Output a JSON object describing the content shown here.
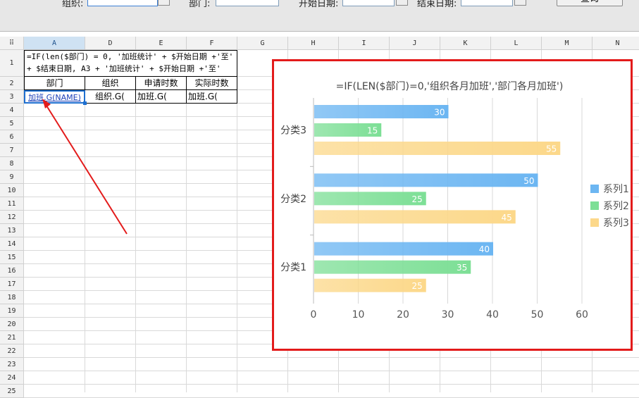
{
  "params": {
    "group_label": "组织:",
    "dept_label": "部门:",
    "start_label": "开始日期:",
    "end_label": "结束日期:",
    "query_button": "查询"
  },
  "sheet": {
    "columns": [
      "A",
      "D",
      "E",
      "F",
      "G",
      "H",
      "I",
      "J",
      "K",
      "L",
      "M",
      "N"
    ],
    "selected_column": "A",
    "rows": [
      "1",
      "2",
      "3",
      "4",
      "5",
      "6",
      "7",
      "8",
      "9",
      "10",
      "11",
      "12",
      "13",
      "14",
      "15",
      "16",
      "17",
      "18",
      "19",
      "20",
      "21",
      "22",
      "23",
      "24",
      "25"
    ],
    "formula_line1": "=IF(len($部门) = 0, '加班统计' + $开始日期 +'至'",
    "formula_line2": "+ $结束日期, A3 + '加班统计' + $开始日期 +'至'",
    "headers": [
      "部门",
      "组织",
      "申请时数",
      "实际时数"
    ],
    "row3": [
      "加班.G(NAME)",
      "组织.G(",
      "加班.G(",
      "加班.G("
    ]
  },
  "chart_data": {
    "type": "bar",
    "orientation": "horizontal",
    "title": "=IF(LEN($部门)=0,'组织各月加班','部门各月加班')",
    "categories": [
      "分类3",
      "分类2",
      "分类1"
    ],
    "series": [
      {
        "name": "系列1",
        "values": [
          30,
          50,
          40
        ],
        "color": "#6cb6f2"
      },
      {
        "name": "系列2",
        "values": [
          15,
          25,
          35
        ],
        "color": "#7ddf96"
      },
      {
        "name": "系列3",
        "values": [
          55,
          45,
          25
        ],
        "color": "#fcd88a"
      }
    ],
    "xlim": [
      0,
      60
    ],
    "xticks": [
      "0",
      "10",
      "20",
      "30",
      "40",
      "50",
      "60"
    ],
    "grid": true,
    "legend": "right"
  },
  "colors": {
    "frame": "#e31b1b",
    "arrow": "#e31b1b",
    "selection": "#1e6fd0"
  }
}
